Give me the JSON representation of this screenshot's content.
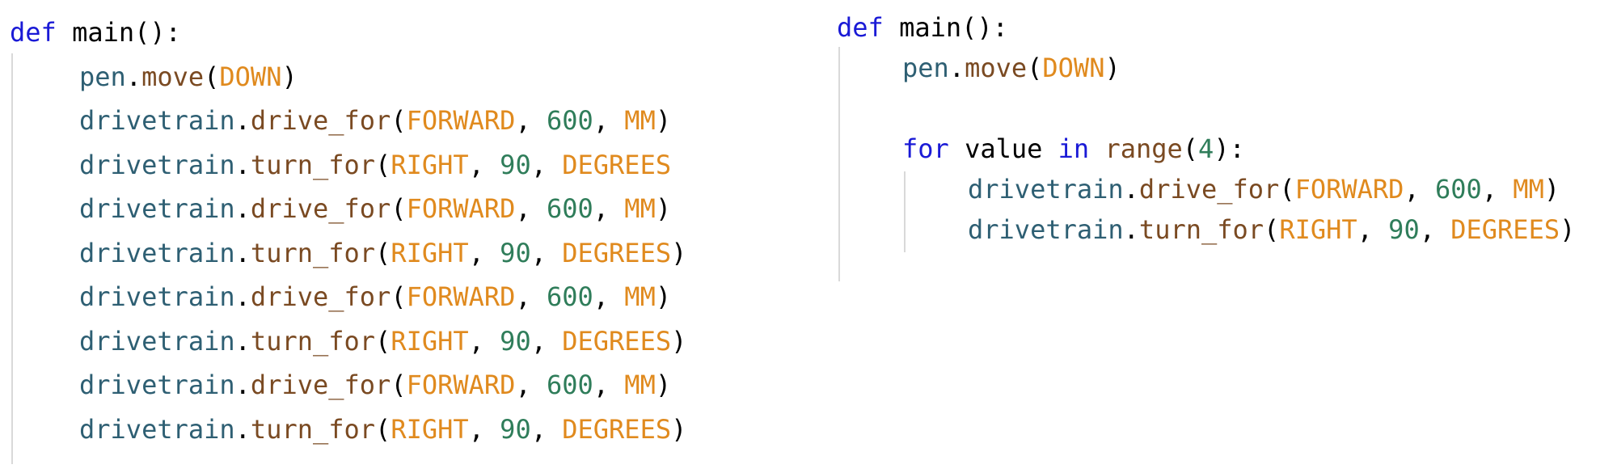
{
  "left_panel": {
    "lines": [
      {
        "indent": 0,
        "tokens": [
          {
            "t": "def",
            "c": "kw"
          },
          {
            "t": " main():",
            "c": "plain"
          }
        ]
      },
      {
        "indent": 1,
        "tokens": [
          {
            "t": "pen",
            "c": "var"
          },
          {
            "t": ".",
            "c": "plain"
          },
          {
            "t": "move",
            "c": "fn"
          },
          {
            "t": "(",
            "c": "plain"
          },
          {
            "t": "DOWN",
            "c": "cst"
          },
          {
            "t": ")",
            "c": "plain"
          }
        ]
      },
      {
        "indent": 1,
        "tokens": [
          {
            "t": "drivetrain",
            "c": "var"
          },
          {
            "t": ".",
            "c": "plain"
          },
          {
            "t": "drive_for",
            "c": "fn"
          },
          {
            "t": "(",
            "c": "plain"
          },
          {
            "t": "FORWARD",
            "c": "cst"
          },
          {
            "t": ", ",
            "c": "plain"
          },
          {
            "t": "600",
            "c": "num"
          },
          {
            "t": ", ",
            "c": "plain"
          },
          {
            "t": "MM",
            "c": "cst"
          },
          {
            "t": ")",
            "c": "plain"
          }
        ]
      },
      {
        "indent": 1,
        "tokens": [
          {
            "t": "drivetrain",
            "c": "var"
          },
          {
            "t": ".",
            "c": "plain"
          },
          {
            "t": "turn_for",
            "c": "fn"
          },
          {
            "t": "(",
            "c": "plain"
          },
          {
            "t": "RIGHT",
            "c": "cst"
          },
          {
            "t": ", ",
            "c": "plain"
          },
          {
            "t": "90",
            "c": "num"
          },
          {
            "t": ", ",
            "c": "plain"
          },
          {
            "t": "DEGREES",
            "c": "cst"
          }
        ]
      },
      {
        "indent": 1,
        "tokens": [
          {
            "t": "drivetrain",
            "c": "var"
          },
          {
            "t": ".",
            "c": "plain"
          },
          {
            "t": "drive_for",
            "c": "fn"
          },
          {
            "t": "(",
            "c": "plain"
          },
          {
            "t": "FORWARD",
            "c": "cst"
          },
          {
            "t": ", ",
            "c": "plain"
          },
          {
            "t": "600",
            "c": "num"
          },
          {
            "t": ", ",
            "c": "plain"
          },
          {
            "t": "MM",
            "c": "cst"
          },
          {
            "t": ")",
            "c": "plain"
          }
        ]
      },
      {
        "indent": 1,
        "tokens": [
          {
            "t": "drivetrain",
            "c": "var"
          },
          {
            "t": ".",
            "c": "plain"
          },
          {
            "t": "turn_for",
            "c": "fn"
          },
          {
            "t": "(",
            "c": "plain"
          },
          {
            "t": "RIGHT",
            "c": "cst"
          },
          {
            "t": ", ",
            "c": "plain"
          },
          {
            "t": "90",
            "c": "num"
          },
          {
            "t": ", ",
            "c": "plain"
          },
          {
            "t": "DEGREES",
            "c": "cst"
          },
          {
            "t": ")",
            "c": "plain"
          }
        ]
      },
      {
        "indent": 1,
        "tokens": [
          {
            "t": "drivetrain",
            "c": "var"
          },
          {
            "t": ".",
            "c": "plain"
          },
          {
            "t": "drive_for",
            "c": "fn"
          },
          {
            "t": "(",
            "c": "plain"
          },
          {
            "t": "FORWARD",
            "c": "cst"
          },
          {
            "t": ", ",
            "c": "plain"
          },
          {
            "t": "600",
            "c": "num"
          },
          {
            "t": ", ",
            "c": "plain"
          },
          {
            "t": "MM",
            "c": "cst"
          },
          {
            "t": ")",
            "c": "plain"
          }
        ]
      },
      {
        "indent": 1,
        "tokens": [
          {
            "t": "drivetrain",
            "c": "var"
          },
          {
            "t": ".",
            "c": "plain"
          },
          {
            "t": "turn_for",
            "c": "fn"
          },
          {
            "t": "(",
            "c": "plain"
          },
          {
            "t": "RIGHT",
            "c": "cst"
          },
          {
            "t": ", ",
            "c": "plain"
          },
          {
            "t": "90",
            "c": "num"
          },
          {
            "t": ", ",
            "c": "plain"
          },
          {
            "t": "DEGREES",
            "c": "cst"
          },
          {
            "t": ")",
            "c": "plain"
          }
        ]
      },
      {
        "indent": 1,
        "tokens": [
          {
            "t": "drivetrain",
            "c": "var"
          },
          {
            "t": ".",
            "c": "plain"
          },
          {
            "t": "drive_for",
            "c": "fn"
          },
          {
            "t": "(",
            "c": "plain"
          },
          {
            "t": "FORWARD",
            "c": "cst"
          },
          {
            "t": ", ",
            "c": "plain"
          },
          {
            "t": "600",
            "c": "num"
          },
          {
            "t": ", ",
            "c": "plain"
          },
          {
            "t": "MM",
            "c": "cst"
          },
          {
            "t": ")",
            "c": "plain"
          }
        ]
      },
      {
        "indent": 1,
        "tokens": [
          {
            "t": "drivetrain",
            "c": "var"
          },
          {
            "t": ".",
            "c": "plain"
          },
          {
            "t": "turn_for",
            "c": "fn"
          },
          {
            "t": "(",
            "c": "plain"
          },
          {
            "t": "RIGHT",
            "c": "cst"
          },
          {
            "t": ", ",
            "c": "plain"
          },
          {
            "t": "90",
            "c": "num"
          },
          {
            "t": ", ",
            "c": "plain"
          },
          {
            "t": "DEGREES",
            "c": "cst"
          },
          {
            "t": ")",
            "c": "plain"
          }
        ]
      }
    ]
  },
  "right_panel": {
    "lines": [
      {
        "indent": 0,
        "tokens": [
          {
            "t": "def",
            "c": "kw"
          },
          {
            "t": " main():",
            "c": "plain"
          }
        ]
      },
      {
        "indent": 1,
        "tokens": [
          {
            "t": "pen",
            "c": "var"
          },
          {
            "t": ".",
            "c": "plain"
          },
          {
            "t": "move",
            "c": "fn"
          },
          {
            "t": "(",
            "c": "plain"
          },
          {
            "t": "DOWN",
            "c": "cst"
          },
          {
            "t": ")",
            "c": "plain"
          }
        ]
      },
      {
        "indent": 1,
        "tokens": []
      },
      {
        "indent": 1,
        "tokens": [
          {
            "t": "for",
            "c": "kw"
          },
          {
            "t": " value ",
            "c": "plain"
          },
          {
            "t": "in",
            "c": "kw"
          },
          {
            "t": " ",
            "c": "plain"
          },
          {
            "t": "range",
            "c": "fn"
          },
          {
            "t": "(",
            "c": "plain"
          },
          {
            "t": "4",
            "c": "num"
          },
          {
            "t": "):",
            "c": "plain"
          }
        ]
      },
      {
        "indent": 2,
        "tokens": [
          {
            "t": "drivetrain",
            "c": "var"
          },
          {
            "t": ".",
            "c": "plain"
          },
          {
            "t": "drive_for",
            "c": "fn"
          },
          {
            "t": "(",
            "c": "plain"
          },
          {
            "t": "FORWARD",
            "c": "cst"
          },
          {
            "t": ", ",
            "c": "plain"
          },
          {
            "t": "600",
            "c": "num"
          },
          {
            "t": ", ",
            "c": "plain"
          },
          {
            "t": "MM",
            "c": "cst"
          },
          {
            "t": ")",
            "c": "plain"
          }
        ]
      },
      {
        "indent": 2,
        "tokens": [
          {
            "t": "drivetrain",
            "c": "var"
          },
          {
            "t": ".",
            "c": "plain"
          },
          {
            "t": "turn_for",
            "c": "fn"
          },
          {
            "t": "(",
            "c": "plain"
          },
          {
            "t": "RIGHT",
            "c": "cst"
          },
          {
            "t": ", ",
            "c": "plain"
          },
          {
            "t": "90",
            "c": "num"
          },
          {
            "t": ", ",
            "c": "plain"
          },
          {
            "t": "DEGREES",
            "c": "cst"
          },
          {
            "t": ")",
            "c": "plain"
          }
        ]
      }
    ]
  },
  "colors": {
    "keyword": "#1a1ad6",
    "variable": "#2e5f73",
    "function": "#7a4a22",
    "constant": "#e08a1e",
    "number": "#2f7d5a",
    "plain": "#000000"
  }
}
